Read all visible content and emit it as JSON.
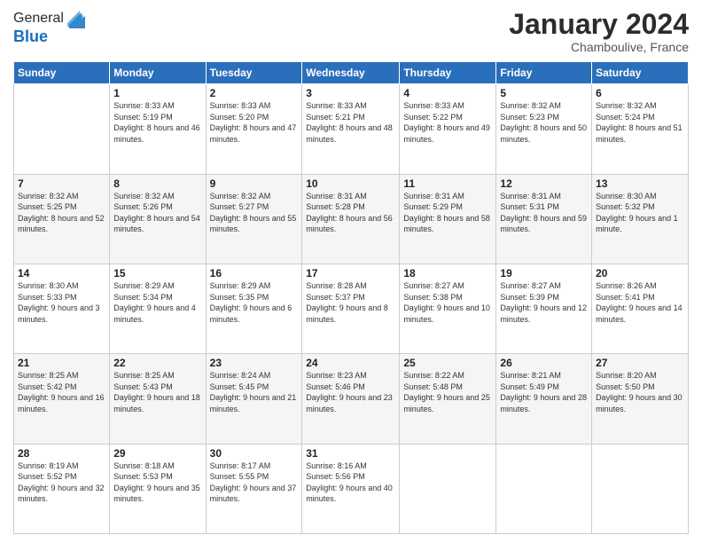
{
  "header": {
    "logo_general": "General",
    "logo_blue": "Blue",
    "month": "January 2024",
    "location": "Chamboulive, France"
  },
  "weekdays": [
    "Sunday",
    "Monday",
    "Tuesday",
    "Wednesday",
    "Thursday",
    "Friday",
    "Saturday"
  ],
  "weeks": [
    [
      {
        "day": "",
        "sunrise": "",
        "sunset": "",
        "daylight": ""
      },
      {
        "day": "1",
        "sunrise": "Sunrise: 8:33 AM",
        "sunset": "Sunset: 5:19 PM",
        "daylight": "Daylight: 8 hours and 46 minutes."
      },
      {
        "day": "2",
        "sunrise": "Sunrise: 8:33 AM",
        "sunset": "Sunset: 5:20 PM",
        "daylight": "Daylight: 8 hours and 47 minutes."
      },
      {
        "day": "3",
        "sunrise": "Sunrise: 8:33 AM",
        "sunset": "Sunset: 5:21 PM",
        "daylight": "Daylight: 8 hours and 48 minutes."
      },
      {
        "day": "4",
        "sunrise": "Sunrise: 8:33 AM",
        "sunset": "Sunset: 5:22 PM",
        "daylight": "Daylight: 8 hours and 49 minutes."
      },
      {
        "day": "5",
        "sunrise": "Sunrise: 8:32 AM",
        "sunset": "Sunset: 5:23 PM",
        "daylight": "Daylight: 8 hours and 50 minutes."
      },
      {
        "day": "6",
        "sunrise": "Sunrise: 8:32 AM",
        "sunset": "Sunset: 5:24 PM",
        "daylight": "Daylight: 8 hours and 51 minutes."
      }
    ],
    [
      {
        "day": "7",
        "sunrise": "Sunrise: 8:32 AM",
        "sunset": "Sunset: 5:25 PM",
        "daylight": "Daylight: 8 hours and 52 minutes."
      },
      {
        "day": "8",
        "sunrise": "Sunrise: 8:32 AM",
        "sunset": "Sunset: 5:26 PM",
        "daylight": "Daylight: 8 hours and 54 minutes."
      },
      {
        "day": "9",
        "sunrise": "Sunrise: 8:32 AM",
        "sunset": "Sunset: 5:27 PM",
        "daylight": "Daylight: 8 hours and 55 minutes."
      },
      {
        "day": "10",
        "sunrise": "Sunrise: 8:31 AM",
        "sunset": "Sunset: 5:28 PM",
        "daylight": "Daylight: 8 hours and 56 minutes."
      },
      {
        "day": "11",
        "sunrise": "Sunrise: 8:31 AM",
        "sunset": "Sunset: 5:29 PM",
        "daylight": "Daylight: 8 hours and 58 minutes."
      },
      {
        "day": "12",
        "sunrise": "Sunrise: 8:31 AM",
        "sunset": "Sunset: 5:31 PM",
        "daylight": "Daylight: 8 hours and 59 minutes."
      },
      {
        "day": "13",
        "sunrise": "Sunrise: 8:30 AM",
        "sunset": "Sunset: 5:32 PM",
        "daylight": "Daylight: 9 hours and 1 minute."
      }
    ],
    [
      {
        "day": "14",
        "sunrise": "Sunrise: 8:30 AM",
        "sunset": "Sunset: 5:33 PM",
        "daylight": "Daylight: 9 hours and 3 minutes."
      },
      {
        "day": "15",
        "sunrise": "Sunrise: 8:29 AM",
        "sunset": "Sunset: 5:34 PM",
        "daylight": "Daylight: 9 hours and 4 minutes."
      },
      {
        "day": "16",
        "sunrise": "Sunrise: 8:29 AM",
        "sunset": "Sunset: 5:35 PM",
        "daylight": "Daylight: 9 hours and 6 minutes."
      },
      {
        "day": "17",
        "sunrise": "Sunrise: 8:28 AM",
        "sunset": "Sunset: 5:37 PM",
        "daylight": "Daylight: 9 hours and 8 minutes."
      },
      {
        "day": "18",
        "sunrise": "Sunrise: 8:27 AM",
        "sunset": "Sunset: 5:38 PM",
        "daylight": "Daylight: 9 hours and 10 minutes."
      },
      {
        "day": "19",
        "sunrise": "Sunrise: 8:27 AM",
        "sunset": "Sunset: 5:39 PM",
        "daylight": "Daylight: 9 hours and 12 minutes."
      },
      {
        "day": "20",
        "sunrise": "Sunrise: 8:26 AM",
        "sunset": "Sunset: 5:41 PM",
        "daylight": "Daylight: 9 hours and 14 minutes."
      }
    ],
    [
      {
        "day": "21",
        "sunrise": "Sunrise: 8:25 AM",
        "sunset": "Sunset: 5:42 PM",
        "daylight": "Daylight: 9 hours and 16 minutes."
      },
      {
        "day": "22",
        "sunrise": "Sunrise: 8:25 AM",
        "sunset": "Sunset: 5:43 PM",
        "daylight": "Daylight: 9 hours and 18 minutes."
      },
      {
        "day": "23",
        "sunrise": "Sunrise: 8:24 AM",
        "sunset": "Sunset: 5:45 PM",
        "daylight": "Daylight: 9 hours and 21 minutes."
      },
      {
        "day": "24",
        "sunrise": "Sunrise: 8:23 AM",
        "sunset": "Sunset: 5:46 PM",
        "daylight": "Daylight: 9 hours and 23 minutes."
      },
      {
        "day": "25",
        "sunrise": "Sunrise: 8:22 AM",
        "sunset": "Sunset: 5:48 PM",
        "daylight": "Daylight: 9 hours and 25 minutes."
      },
      {
        "day": "26",
        "sunrise": "Sunrise: 8:21 AM",
        "sunset": "Sunset: 5:49 PM",
        "daylight": "Daylight: 9 hours and 28 minutes."
      },
      {
        "day": "27",
        "sunrise": "Sunrise: 8:20 AM",
        "sunset": "Sunset: 5:50 PM",
        "daylight": "Daylight: 9 hours and 30 minutes."
      }
    ],
    [
      {
        "day": "28",
        "sunrise": "Sunrise: 8:19 AM",
        "sunset": "Sunset: 5:52 PM",
        "daylight": "Daylight: 9 hours and 32 minutes."
      },
      {
        "day": "29",
        "sunrise": "Sunrise: 8:18 AM",
        "sunset": "Sunset: 5:53 PM",
        "daylight": "Daylight: 9 hours and 35 minutes."
      },
      {
        "day": "30",
        "sunrise": "Sunrise: 8:17 AM",
        "sunset": "Sunset: 5:55 PM",
        "daylight": "Daylight: 9 hours and 37 minutes."
      },
      {
        "day": "31",
        "sunrise": "Sunrise: 8:16 AM",
        "sunset": "Sunset: 5:56 PM",
        "daylight": "Daylight: 9 hours and 40 minutes."
      },
      {
        "day": "",
        "sunrise": "",
        "sunset": "",
        "daylight": ""
      },
      {
        "day": "",
        "sunrise": "",
        "sunset": "",
        "daylight": ""
      },
      {
        "day": "",
        "sunrise": "",
        "sunset": "",
        "daylight": ""
      }
    ]
  ]
}
